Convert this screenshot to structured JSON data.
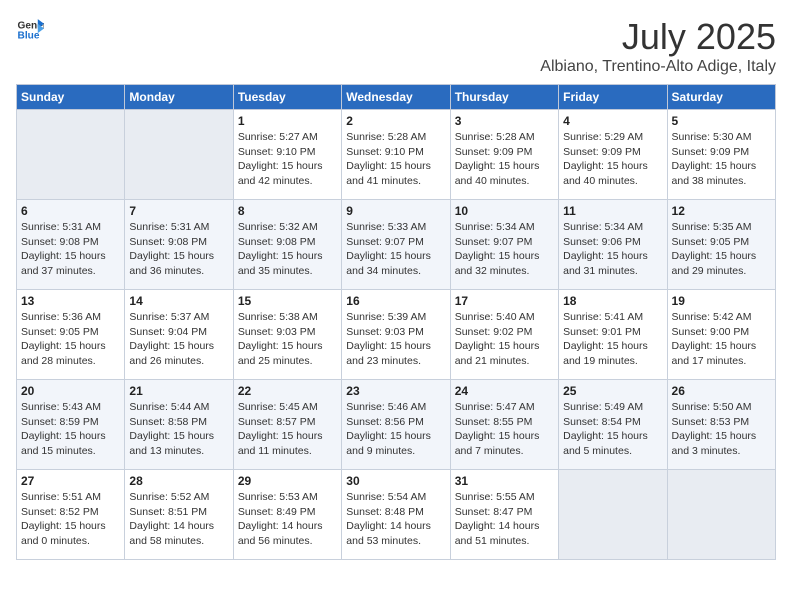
{
  "header": {
    "logo_line1": "General",
    "logo_line2": "Blue",
    "title": "July 2025",
    "subtitle": "Albiano, Trentino-Alto Adige, Italy"
  },
  "days_of_week": [
    "Sunday",
    "Monday",
    "Tuesday",
    "Wednesday",
    "Thursday",
    "Friday",
    "Saturday"
  ],
  "weeks": [
    [
      {
        "day": "",
        "info": ""
      },
      {
        "day": "",
        "info": ""
      },
      {
        "day": "1",
        "info": "Sunrise: 5:27 AM\nSunset: 9:10 PM\nDaylight: 15 hours and 42 minutes."
      },
      {
        "day": "2",
        "info": "Sunrise: 5:28 AM\nSunset: 9:10 PM\nDaylight: 15 hours and 41 minutes."
      },
      {
        "day": "3",
        "info": "Sunrise: 5:28 AM\nSunset: 9:09 PM\nDaylight: 15 hours and 40 minutes."
      },
      {
        "day": "4",
        "info": "Sunrise: 5:29 AM\nSunset: 9:09 PM\nDaylight: 15 hours and 40 minutes."
      },
      {
        "day": "5",
        "info": "Sunrise: 5:30 AM\nSunset: 9:09 PM\nDaylight: 15 hours and 38 minutes."
      }
    ],
    [
      {
        "day": "6",
        "info": "Sunrise: 5:31 AM\nSunset: 9:08 PM\nDaylight: 15 hours and 37 minutes."
      },
      {
        "day": "7",
        "info": "Sunrise: 5:31 AM\nSunset: 9:08 PM\nDaylight: 15 hours and 36 minutes."
      },
      {
        "day": "8",
        "info": "Sunrise: 5:32 AM\nSunset: 9:08 PM\nDaylight: 15 hours and 35 minutes."
      },
      {
        "day": "9",
        "info": "Sunrise: 5:33 AM\nSunset: 9:07 PM\nDaylight: 15 hours and 34 minutes."
      },
      {
        "day": "10",
        "info": "Sunrise: 5:34 AM\nSunset: 9:07 PM\nDaylight: 15 hours and 32 minutes."
      },
      {
        "day": "11",
        "info": "Sunrise: 5:34 AM\nSunset: 9:06 PM\nDaylight: 15 hours and 31 minutes."
      },
      {
        "day": "12",
        "info": "Sunrise: 5:35 AM\nSunset: 9:05 PM\nDaylight: 15 hours and 29 minutes."
      }
    ],
    [
      {
        "day": "13",
        "info": "Sunrise: 5:36 AM\nSunset: 9:05 PM\nDaylight: 15 hours and 28 minutes."
      },
      {
        "day": "14",
        "info": "Sunrise: 5:37 AM\nSunset: 9:04 PM\nDaylight: 15 hours and 26 minutes."
      },
      {
        "day": "15",
        "info": "Sunrise: 5:38 AM\nSunset: 9:03 PM\nDaylight: 15 hours and 25 minutes."
      },
      {
        "day": "16",
        "info": "Sunrise: 5:39 AM\nSunset: 9:03 PM\nDaylight: 15 hours and 23 minutes."
      },
      {
        "day": "17",
        "info": "Sunrise: 5:40 AM\nSunset: 9:02 PM\nDaylight: 15 hours and 21 minutes."
      },
      {
        "day": "18",
        "info": "Sunrise: 5:41 AM\nSunset: 9:01 PM\nDaylight: 15 hours and 19 minutes."
      },
      {
        "day": "19",
        "info": "Sunrise: 5:42 AM\nSunset: 9:00 PM\nDaylight: 15 hours and 17 minutes."
      }
    ],
    [
      {
        "day": "20",
        "info": "Sunrise: 5:43 AM\nSunset: 8:59 PM\nDaylight: 15 hours and 15 minutes."
      },
      {
        "day": "21",
        "info": "Sunrise: 5:44 AM\nSunset: 8:58 PM\nDaylight: 15 hours and 13 minutes."
      },
      {
        "day": "22",
        "info": "Sunrise: 5:45 AM\nSunset: 8:57 PM\nDaylight: 15 hours and 11 minutes."
      },
      {
        "day": "23",
        "info": "Sunrise: 5:46 AM\nSunset: 8:56 PM\nDaylight: 15 hours and 9 minutes."
      },
      {
        "day": "24",
        "info": "Sunrise: 5:47 AM\nSunset: 8:55 PM\nDaylight: 15 hours and 7 minutes."
      },
      {
        "day": "25",
        "info": "Sunrise: 5:49 AM\nSunset: 8:54 PM\nDaylight: 15 hours and 5 minutes."
      },
      {
        "day": "26",
        "info": "Sunrise: 5:50 AM\nSunset: 8:53 PM\nDaylight: 15 hours and 3 minutes."
      }
    ],
    [
      {
        "day": "27",
        "info": "Sunrise: 5:51 AM\nSunset: 8:52 PM\nDaylight: 15 hours and 0 minutes."
      },
      {
        "day": "28",
        "info": "Sunrise: 5:52 AM\nSunset: 8:51 PM\nDaylight: 14 hours and 58 minutes."
      },
      {
        "day": "29",
        "info": "Sunrise: 5:53 AM\nSunset: 8:49 PM\nDaylight: 14 hours and 56 minutes."
      },
      {
        "day": "30",
        "info": "Sunrise: 5:54 AM\nSunset: 8:48 PM\nDaylight: 14 hours and 53 minutes."
      },
      {
        "day": "31",
        "info": "Sunrise: 5:55 AM\nSunset: 8:47 PM\nDaylight: 14 hours and 51 minutes."
      },
      {
        "day": "",
        "info": ""
      },
      {
        "day": "",
        "info": ""
      }
    ]
  ]
}
